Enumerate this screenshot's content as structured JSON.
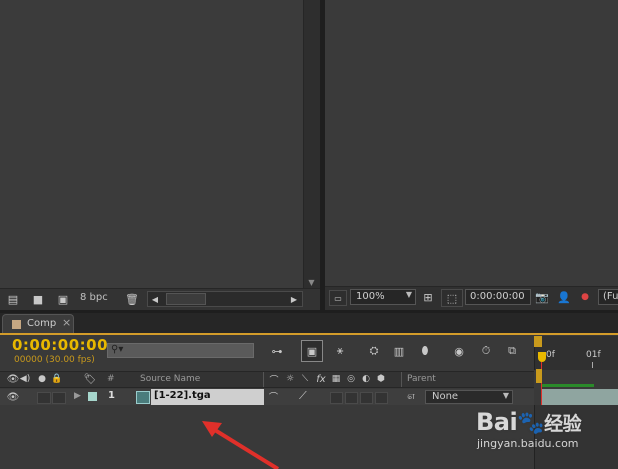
{
  "project_panel": {
    "bpc_label": "8 bpc"
  },
  "viewer": {
    "zoom": "100%",
    "timecode": "0:00:00:00",
    "resolution_partial": "(Fu"
  },
  "timeline": {
    "tab_label": "Comp",
    "tab_close": "×",
    "current_time": "0:00:00:00",
    "frame_info": "00000 (30.00 fps)",
    "search_placeholder": "",
    "columns": {
      "number": "#",
      "source_name": "Source Name",
      "parent": "Parent"
    },
    "layers": [
      {
        "number": "1",
        "source_name": "[1-22].tga",
        "parent": "None"
      }
    ],
    "ruler": {
      "start": "0f",
      "tick1": "01f"
    }
  },
  "colors": {
    "timecode": "#e8b800",
    "layer_label": "#a6d6cc",
    "arrow": "#e0302a",
    "playhead": "#e0302a",
    "work_area": "#2a8a2a"
  },
  "watermark": {
    "brand": "Bai",
    "brand_cn": "经验",
    "url": "jingyan.baidu.com"
  }
}
